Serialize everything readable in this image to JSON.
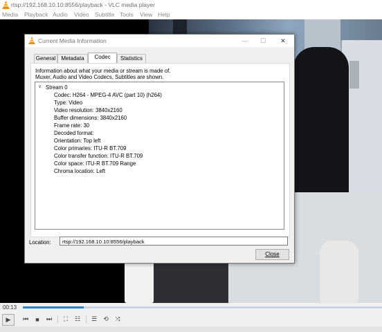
{
  "window": {
    "title": "rtsp://192.168.10.10:8556/playback - VLC media player"
  },
  "menu": [
    "Media",
    "Playback",
    "Audio",
    "Video",
    "Subtitle",
    "Tools",
    "View",
    "Help"
  ],
  "dialog": {
    "title": "Current Media Information",
    "window_buttons": {
      "minimize": "—",
      "maximize": "☐",
      "close": "✕"
    },
    "tabs": [
      {
        "label": "General",
        "active": false
      },
      {
        "label": "Metadata",
        "active": false
      },
      {
        "label": "Codec",
        "active": true
      },
      {
        "label": "Statistics",
        "active": false
      }
    ],
    "description": "Information about what your media or stream is made of.\nMuxer, Audio and Video Codecs, Subtitles are shown.",
    "tree": {
      "toggle": "∨",
      "root": "Stream 0",
      "rows": [
        "Codec: H264 - MPEG-4 AVC (part 10) (h264)",
        "Type: Video",
        "Video resolution: 3840x2160",
        "Buffer dimensions: 3840x2160",
        "Frame rate: 30",
        "Decoded format:",
        "Orientation: Top left",
        "Color primaries: ITU-R BT.709",
        "Color transfer function: ITU-R BT.709",
        "Color space: ITU-R BT.709 Range",
        "Chroma location: Left"
      ]
    },
    "location": {
      "label": "Location:",
      "value": "rtsp://192.168.10.10:8556/playback"
    },
    "close_button": "Close"
  },
  "player": {
    "time_elapsed": "00:13",
    "seek_progress": 0.17,
    "controls": [
      {
        "name": "play-button",
        "icon": "play-icon",
        "glyph": "▶"
      },
      {
        "name": "previous-button",
        "icon": "skip-previous-icon",
        "glyph": "⏮"
      },
      {
        "name": "stop-button",
        "icon": "stop-icon",
        "glyph": "■"
      },
      {
        "name": "next-button",
        "icon": "skip-next-icon",
        "glyph": "⏭"
      },
      {
        "name": "fullscreen-button",
        "icon": "fullscreen-icon",
        "glyph": "⛶"
      },
      {
        "name": "extended-settings-button",
        "icon": "equalizer-icon",
        "glyph": "☷"
      },
      {
        "name": "playlist-button",
        "icon": "playlist-icon",
        "glyph": "☰"
      },
      {
        "name": "loop-button",
        "icon": "loop-icon",
        "glyph": "⟲"
      },
      {
        "name": "shuffle-button",
        "icon": "shuffle-icon",
        "glyph": "⤨"
      }
    ]
  },
  "colors": {
    "accent": "#2d7fd3",
    "vlc_orange": "#f08a00",
    "dialog_bg": "#f0f0f0"
  }
}
